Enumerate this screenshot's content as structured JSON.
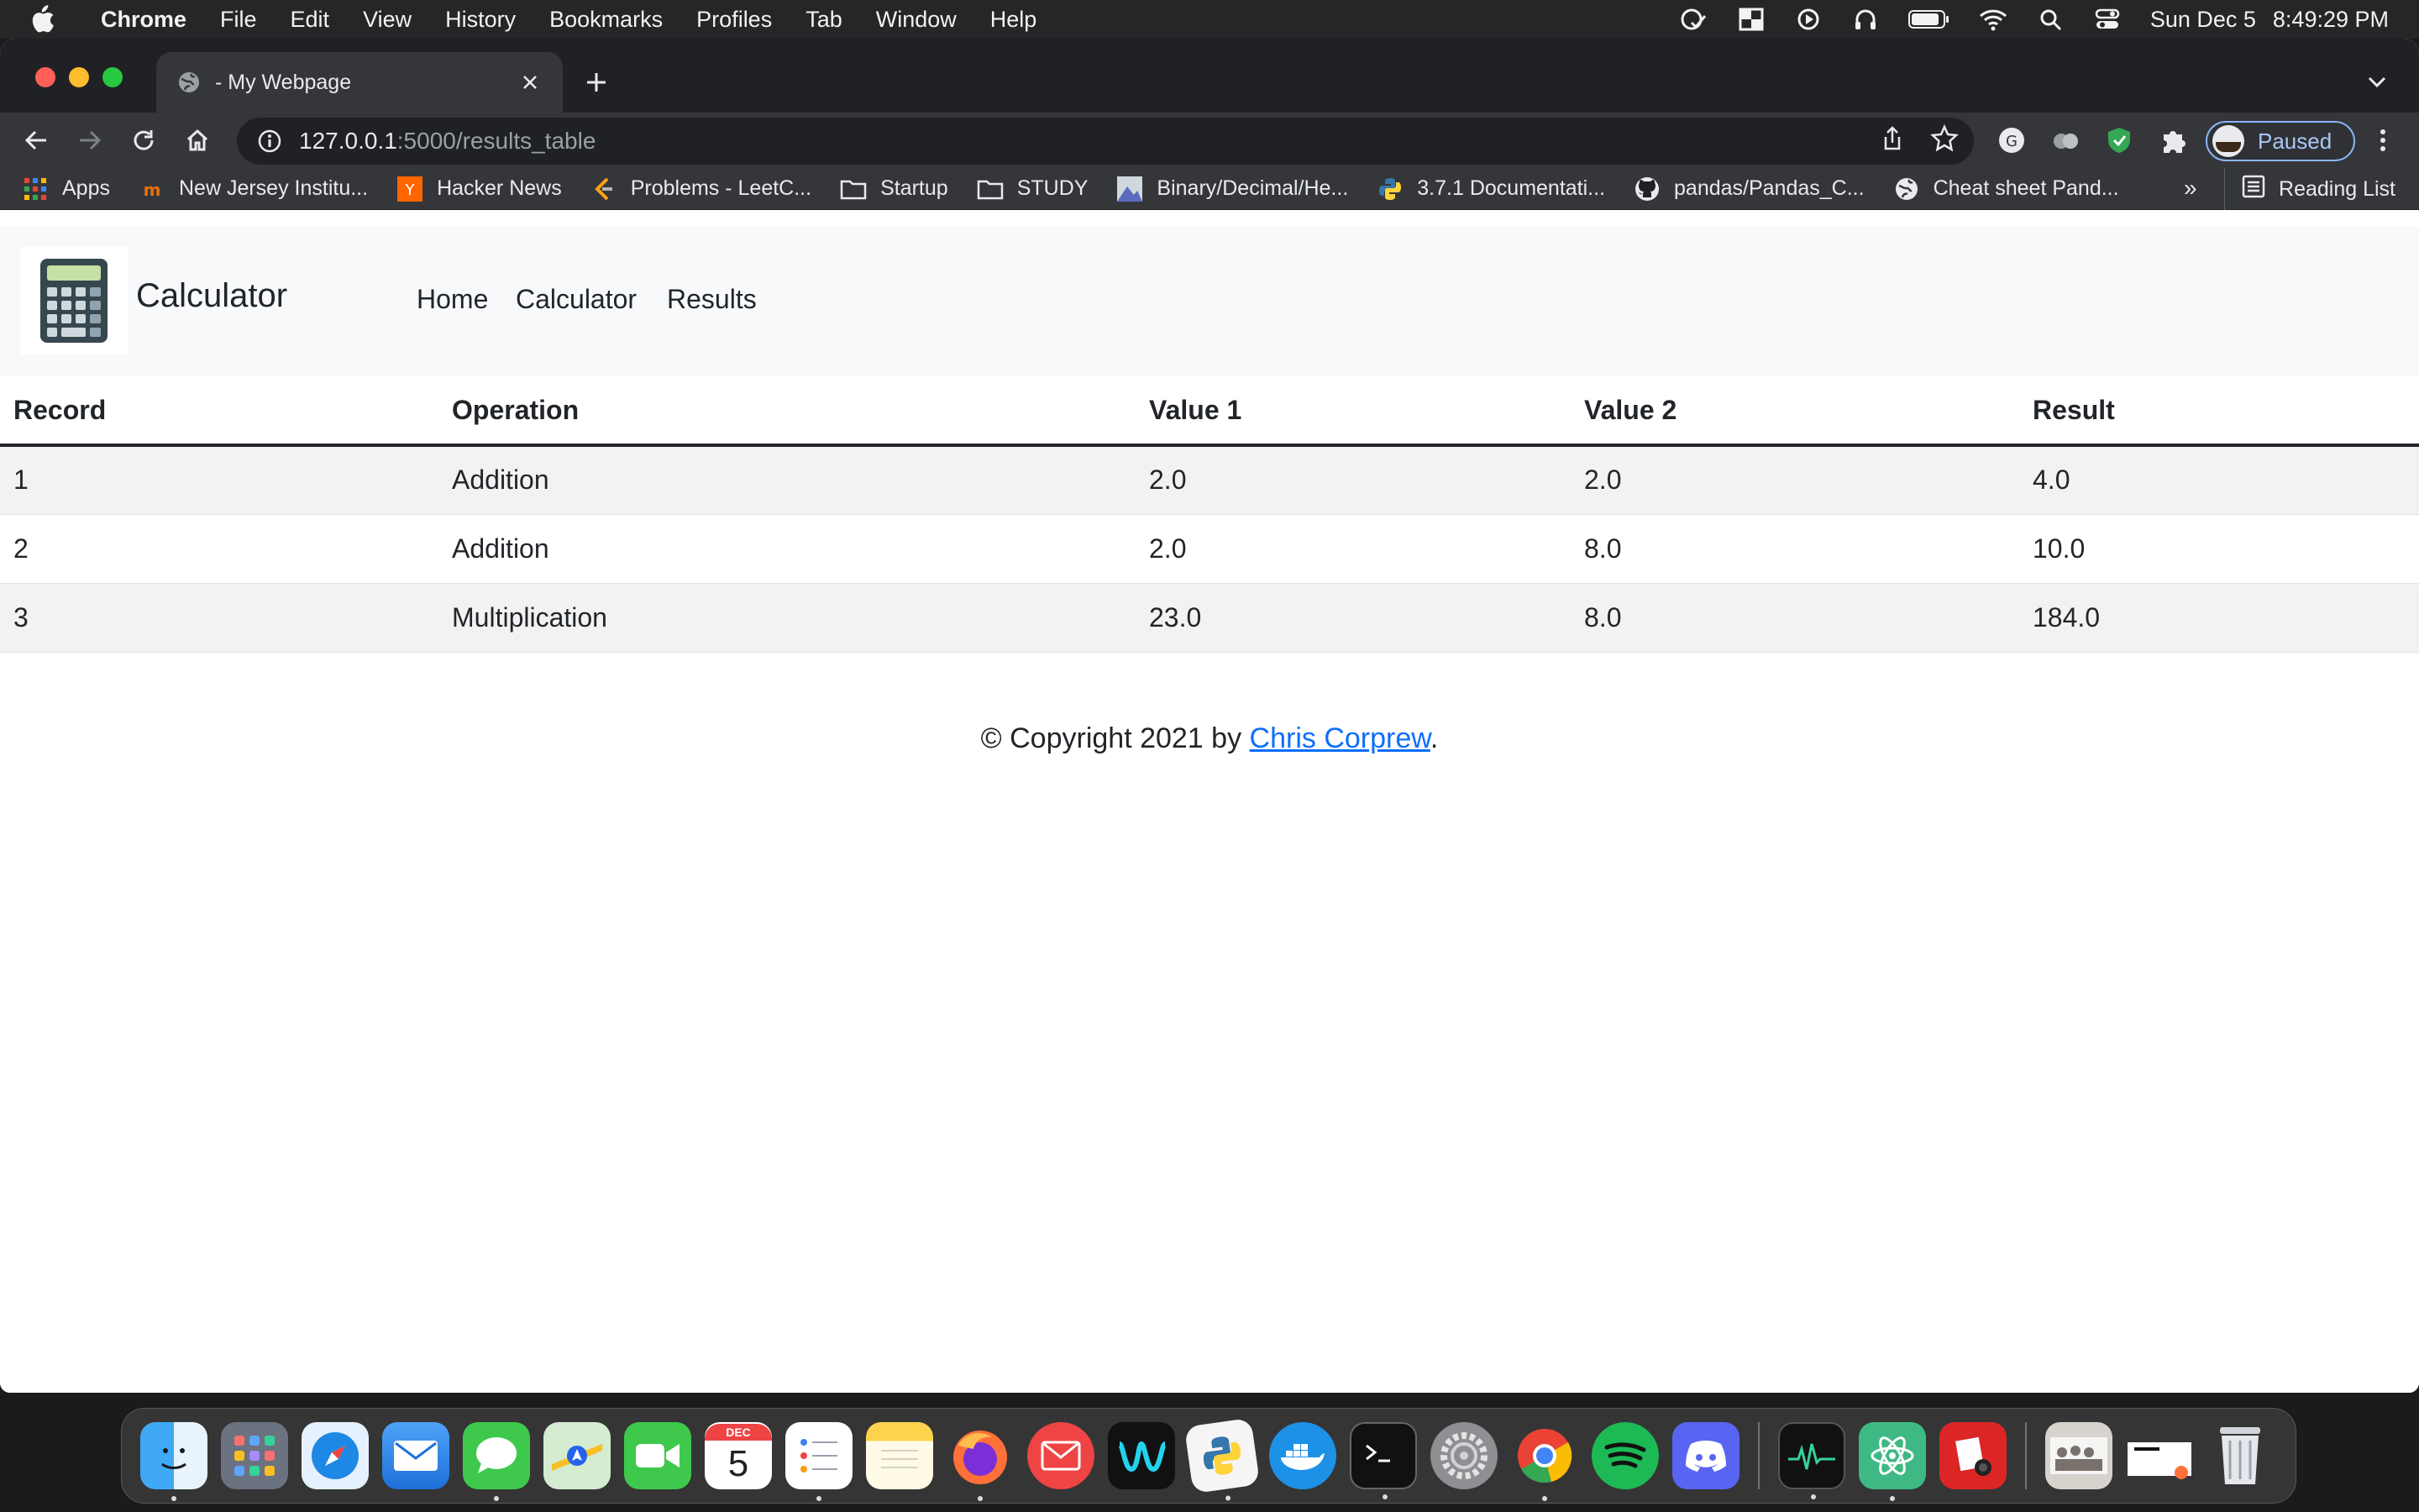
{
  "menubar": {
    "app": "Chrome",
    "items": [
      "File",
      "Edit",
      "View",
      "History",
      "Bookmarks",
      "Profiles",
      "Tab",
      "Window",
      "Help"
    ],
    "date": "Sun Dec 5",
    "time": "8:49:29 PM"
  },
  "tab": {
    "title": "- My Webpage"
  },
  "address": {
    "host": "127.0.0.1",
    "path": ":5000/results_table"
  },
  "profile": {
    "label": "Paused"
  },
  "bookmarks": {
    "items": [
      "Apps",
      "New Jersey Institu...",
      "Hacker News",
      "Problems - LeetC...",
      "Startup",
      "STUDY",
      "Binary/Decimal/He...",
      "3.7.1 Documentati...",
      "pandas/Pandas_C...",
      "Cheat sheet Pand..."
    ],
    "more": "»",
    "reading_list": "Reading List"
  },
  "navbar": {
    "brand": "Calculator",
    "links": [
      "Home",
      "Calculator",
      "Results"
    ]
  },
  "table": {
    "headers": [
      "Record",
      "Operation",
      "Value 1",
      "Value 2",
      "Result"
    ],
    "rows": [
      [
        "1",
        "Addition",
        "2.0",
        "2.0",
        "4.0"
      ],
      [
        "2",
        "Addition",
        "2.0",
        "8.0",
        "10.0"
      ],
      [
        "3",
        "Multiplication",
        "23.0",
        "8.0",
        "184.0"
      ]
    ]
  },
  "footer": {
    "prefix": "© Copyright 2021 by ",
    "author": "Chris Corprew",
    "suffix": "."
  },
  "dock": {
    "calendar_month": "DEC",
    "calendar_day": "5"
  },
  "colors": {
    "link": "#0d6efd",
    "chrome_dark": "#35363a",
    "profile_accent": "#8ab4f8"
  }
}
